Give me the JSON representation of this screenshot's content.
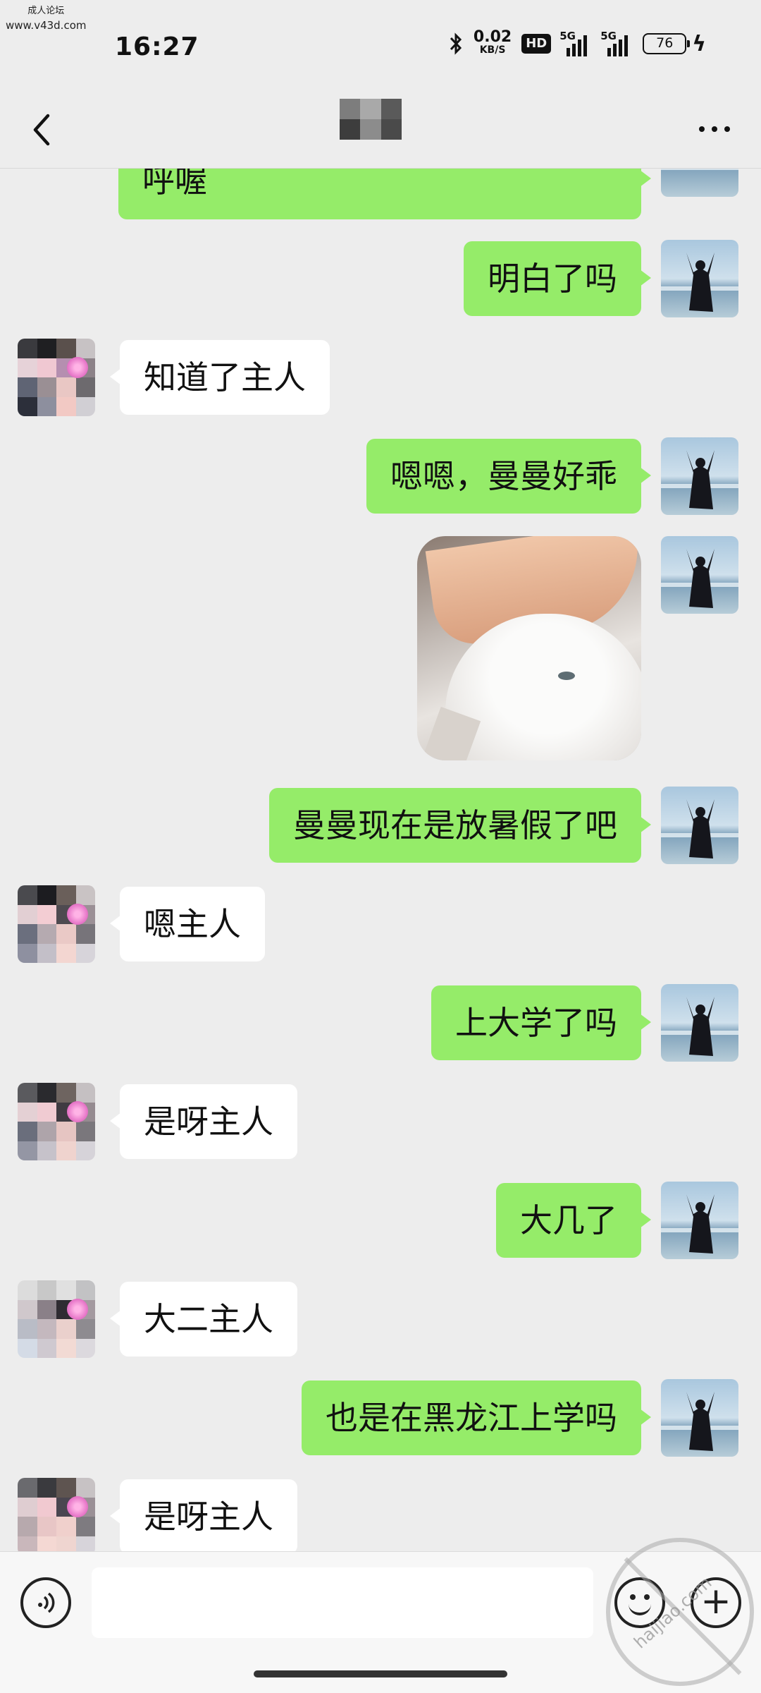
{
  "watermark": {
    "top_line1": "成人论坛",
    "top_line2": "www.v43d.com",
    "stamp_text": "haijiao.com"
  },
  "status_bar": {
    "time": "16:27",
    "net_speed_value": "0.02",
    "net_speed_unit": "KB/S",
    "hd_badge": "HD",
    "signal1_label": "5G",
    "signal2_label": "5G",
    "battery": "76"
  },
  "nav": {
    "back_icon": "chevron-left-icon",
    "more_icon": "more-dots-icon"
  },
  "messages": [
    {
      "from": "self",
      "text": "呼喔"
    },
    {
      "from": "self",
      "text": "明白了吗"
    },
    {
      "from": "other",
      "text": "知道了主人"
    },
    {
      "from": "self",
      "text": "嗯嗯，曼曼好乖"
    },
    {
      "from": "self",
      "type": "image",
      "description": "sticker-image"
    },
    {
      "from": "self",
      "text": "曼曼现在是放暑假了吧"
    },
    {
      "from": "other",
      "text": "嗯主人"
    },
    {
      "from": "self",
      "text": "上大学了吗"
    },
    {
      "from": "other",
      "text": "是呀主人"
    },
    {
      "from": "self",
      "text": "大几了"
    },
    {
      "from": "other",
      "text": "大二主人"
    },
    {
      "from": "self",
      "text": "也是在黑龙江上学吗"
    },
    {
      "from": "other",
      "text": "是呀主人"
    }
  ],
  "input_bar": {
    "voice_icon": "voice-icon",
    "input_value": "",
    "emoji_icon": "emoji-icon",
    "plus_icon": "plus-icon",
    "plus_glyph": "+"
  },
  "colors": {
    "self_bubble": "#95ec69",
    "other_bubble": "#ffffff",
    "background": "#ededed"
  }
}
